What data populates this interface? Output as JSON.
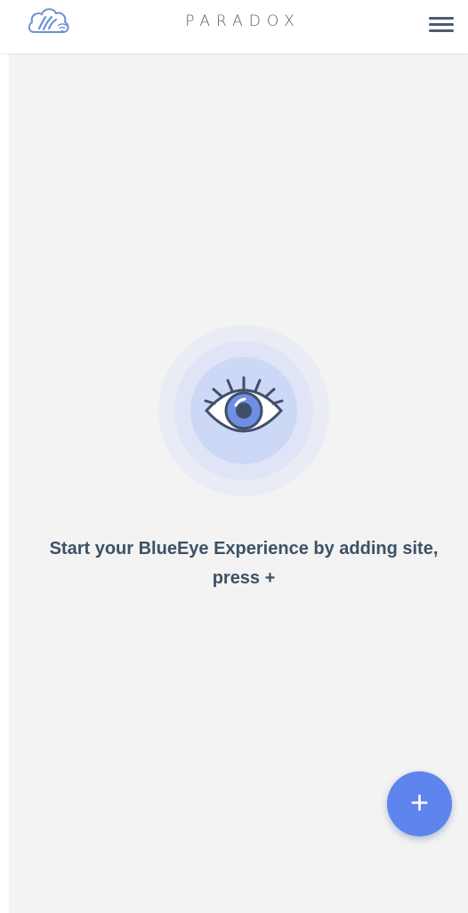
{
  "header": {
    "brand": "PARADOX",
    "logo_icon": "cloud-swan-wifi-logo",
    "menu_icon": "hamburger-menu-icon"
  },
  "empty_state": {
    "icon": "eye-icon",
    "message": "Start your BlueEye Experience by adding site, press +"
  },
  "fab": {
    "label": "+",
    "icon": "plus-icon"
  },
  "colors": {
    "accent": "#5e84ed",
    "header_icon": "#4b5d74",
    "text": "#3d5166",
    "background": "#f3f3f3"
  }
}
